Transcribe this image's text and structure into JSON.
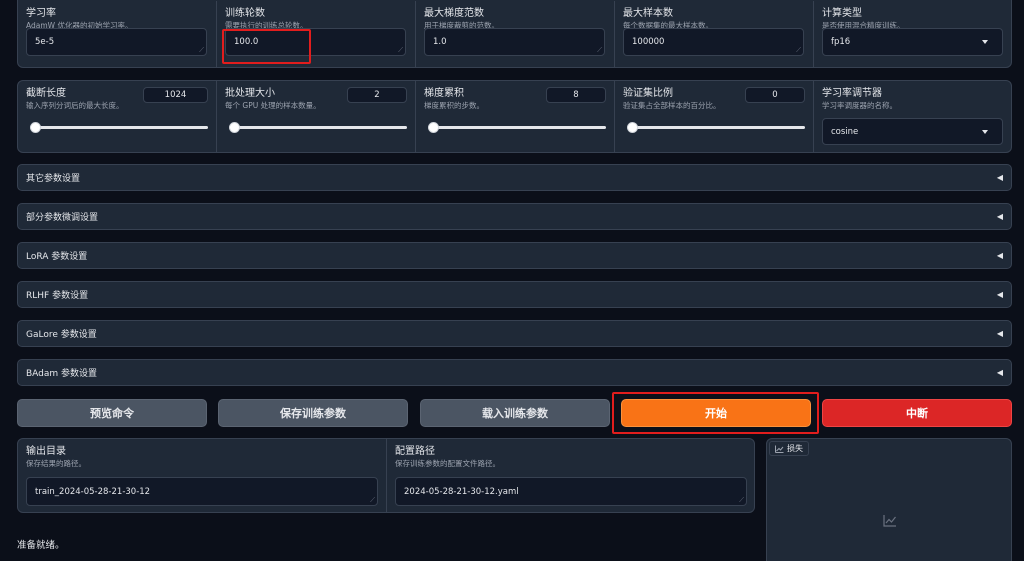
{
  "row1": [
    {
      "label": "学习率",
      "info": "AdamW 优化器的初始学习率。",
      "value": "5e-5"
    },
    {
      "label": "训练轮数",
      "info": "需要执行的训练总轮数。",
      "value": "100.0"
    },
    {
      "label": "最大梯度范数",
      "info": "用于梯度裁剪的范数。",
      "value": "1.0"
    },
    {
      "label": "最大样本数",
      "info": "每个数据集的最大样本数。",
      "value": "100000"
    },
    {
      "label": "计算类型",
      "info": "是否使用混合精度训练。",
      "value": "fp16"
    }
  ],
  "row2": [
    {
      "label": "截断长度",
      "info": "输入序列分词后的最大长度。",
      "value": "1024",
      "level": 0.0
    },
    {
      "label": "批处理大小",
      "info": "每个 GPU 处理的样本数量。",
      "value": "2",
      "level": 0.0
    },
    {
      "label": "梯度累积",
      "info": "梯度累积的步数。",
      "value": "8",
      "level": 0.0
    },
    {
      "label": "验证集比例",
      "info": "验证集占全部样本的百分比。",
      "value": "0",
      "level": 0.0
    }
  ],
  "scheduler": {
    "label": "学习率调节器",
    "info": "学习率调度器的名称。",
    "value": "cosine"
  },
  "accordions": [
    {
      "label": "其它参数设置"
    },
    {
      "label": "部分参数微调设置"
    },
    {
      "label": "LoRA 参数设置"
    },
    {
      "label": "RLHF 参数设置"
    },
    {
      "label": "GaLore 参数设置"
    },
    {
      "label": "BAdam 参数设置"
    }
  ],
  "accordion_icon": "◀",
  "buttons": {
    "preview": "预览命令",
    "save": "保存训练参数",
    "load": "载入训练参数",
    "start": "开始",
    "stop": "中断"
  },
  "output": {
    "dir_label": "输出目录",
    "dir_info": "保存结果的路径。",
    "dir_value": "train_2024-05-28-21-30-12",
    "config_label": "配置路径",
    "config_info": "保存训练参数的配置文件路径。",
    "config_value": "2024-05-28-21-30-12.yaml"
  },
  "loss": {
    "label": "损失",
    "icon": "line-chart-icon"
  },
  "status": "准备就绪。",
  "colors": {
    "accent": "#f97316",
    "stop": "#dc2626",
    "highlight": "#e11d1d"
  }
}
